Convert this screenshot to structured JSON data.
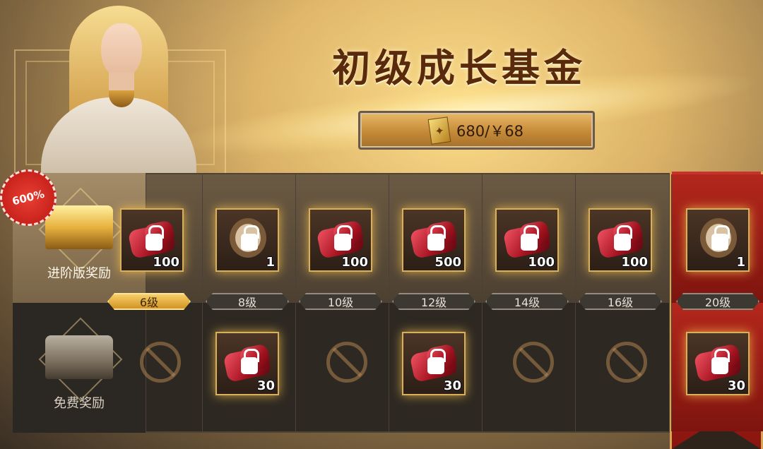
{
  "title": "初级成长基金",
  "price": "680/￥68",
  "badge": "600%",
  "tabs": [
    {
      "label": "进阶版奖励",
      "active": true
    },
    {
      "label": "免费奖励",
      "active": false
    }
  ],
  "levels": [
    "6级",
    "8级",
    "10级",
    "12级",
    "14级",
    "16级",
    "20级"
  ],
  "premium_rewards": [
    {
      "type": "gem",
      "qty": "100"
    },
    {
      "type": "relic",
      "qty": "1"
    },
    {
      "type": "gem",
      "qty": "100"
    },
    {
      "type": "gem",
      "qty": "500"
    },
    {
      "type": "gem",
      "qty": "100"
    },
    {
      "type": "gem",
      "qty": "100"
    },
    {
      "type": "relic",
      "qty": "1"
    }
  ],
  "free_rewards": [
    {
      "type": "empty",
      "qty": ""
    },
    {
      "type": "gem",
      "qty": "30"
    },
    {
      "type": "empty",
      "qty": ""
    },
    {
      "type": "gem",
      "qty": "30"
    },
    {
      "type": "empty",
      "qty": ""
    },
    {
      "type": "empty",
      "qty": ""
    },
    {
      "type": "gem",
      "qty": "30"
    }
  ],
  "colors": {
    "accent": "#d6a653",
    "special": "#c7332b",
    "panel": "#2b2620"
  }
}
